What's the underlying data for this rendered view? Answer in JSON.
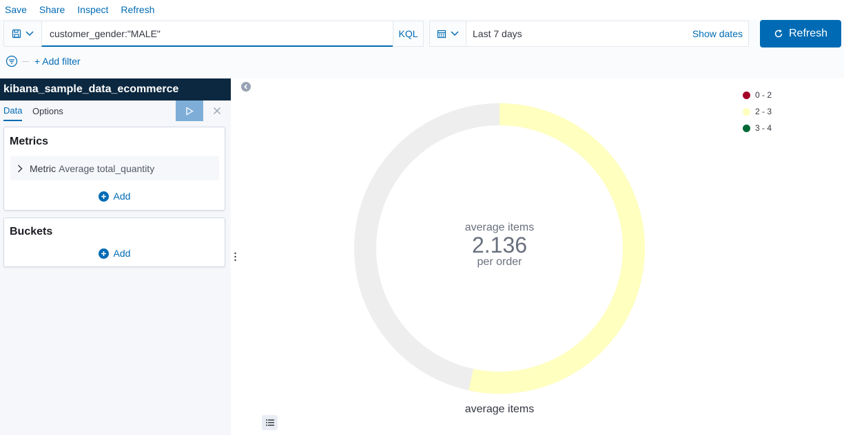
{
  "top_menu": {
    "save": "Save",
    "share": "Share",
    "inspect": "Inspect",
    "refresh": "Refresh"
  },
  "query": {
    "value": "customer_gender:\"MALE\"",
    "language": "KQL"
  },
  "time": {
    "range": "Last 7 days",
    "show_dates": "Show dates",
    "refresh_label": "Refresh"
  },
  "filters": {
    "add_label": "+ Add filter"
  },
  "sidebar": {
    "index_pattern": "kibana_sample_data_ecommerce",
    "tabs": {
      "data": "Data",
      "options": "Options"
    },
    "metrics": {
      "title": "Metrics",
      "row_label": "Metric",
      "row_value": "Average total_quantity",
      "add_label": "Add"
    },
    "buckets": {
      "title": "Buckets",
      "add_label": "Add"
    }
  },
  "chart_data": {
    "type": "gauge",
    "value": 2.136,
    "range": [
      0,
      4
    ],
    "label_top": "average items",
    "value_text": "2.136",
    "label_bottom": "per order",
    "gauge_label": "average items",
    "legend": [
      {
        "name": "0 - 2",
        "color": "#a50026"
      },
      {
        "name": "2 - 3",
        "color": "#ffffbf"
      },
      {
        "name": "3 - 4",
        "color": "#006837"
      }
    ],
    "fill_color": "#ffffbf",
    "track_color": "#eeeeee"
  }
}
